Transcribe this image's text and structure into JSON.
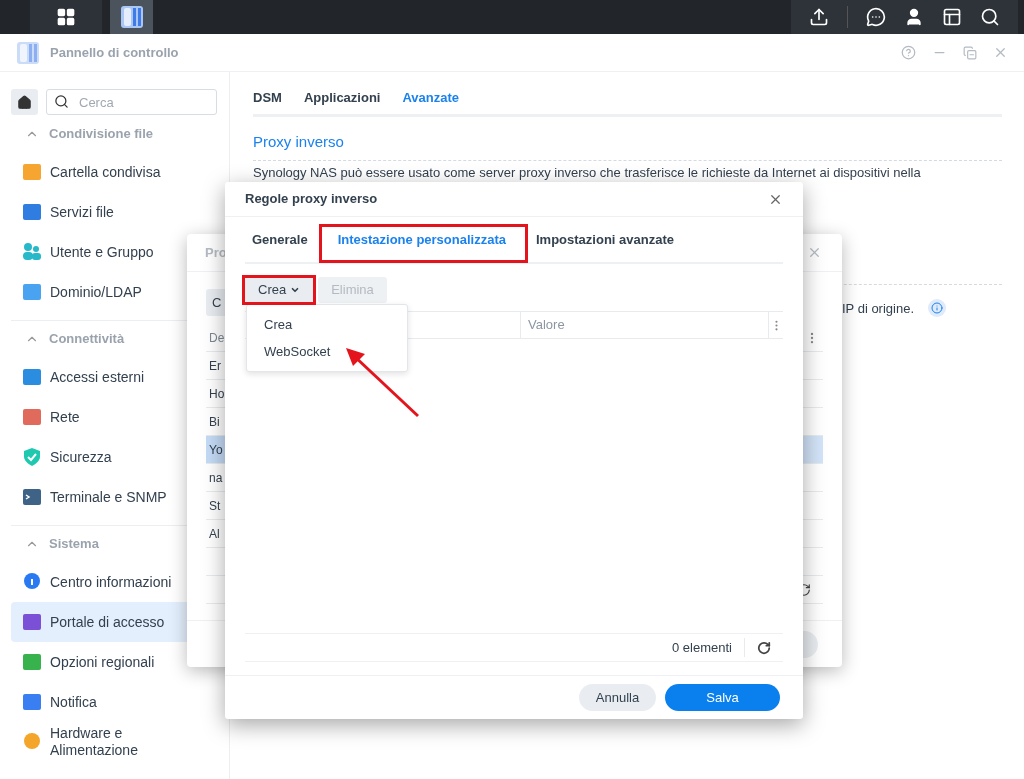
{
  "window": {
    "title": "Pannello di controllo"
  },
  "sidebar": {
    "search": {
      "placeholder": "Cerca"
    },
    "sections": [
      {
        "title": "Condivisione file",
        "expanded": true,
        "items": [
          {
            "label": "Cartella condivisa",
            "selected": false
          },
          {
            "label": "Servizi file",
            "selected": false
          },
          {
            "label": "Utente e Gruppo",
            "selected": false
          },
          {
            "label": "Dominio/LDAP",
            "selected": false
          }
        ]
      },
      {
        "title": "Connettività",
        "expanded": true,
        "items": [
          {
            "label": "Accessi esterni",
            "selected": false
          },
          {
            "label": "Rete",
            "selected": false
          },
          {
            "label": "Sicurezza",
            "selected": false
          },
          {
            "label": "Terminale e SNMP",
            "selected": false
          }
        ]
      },
      {
        "title": "Sistema",
        "expanded": true,
        "items": [
          {
            "label": "Centro informazioni",
            "selected": false
          },
          {
            "label": "Portale di accesso",
            "selected": true
          },
          {
            "label": "Opzioni regionali",
            "selected": false
          },
          {
            "label": "Notifica",
            "selected": false
          },
          {
            "label": "Hardware e Alimentazione",
            "selected": false
          }
        ]
      }
    ]
  },
  "main": {
    "tabs": [
      {
        "label": "DSM",
        "selected": false
      },
      {
        "label": "Applicazioni",
        "selected": false
      },
      {
        "label": "Avanzate",
        "selected": true
      }
    ],
    "section_title": "Proxy inverso",
    "description": "Synology NAS può essere usato come server proxy inverso che trasferisce le richieste da Internet ai dispositivi nella",
    "note": "IP di origine."
  },
  "back_dialog": {
    "title": "Pro",
    "button": "C",
    "header_cell": "De",
    "rows": [
      {
        "cell": "Er",
        "selected": false
      },
      {
        "cell": "Ho",
        "selected": false
      },
      {
        "cell": "Bi",
        "selected": false
      },
      {
        "cell": "Yo",
        "selected": true
      },
      {
        "cell": "na",
        "selected": false
      },
      {
        "cell": "St",
        "selected": false
      },
      {
        "cell": "Al",
        "selected": false
      }
    ]
  },
  "dialog": {
    "title": "Regole proxy inverso",
    "tabs": [
      {
        "label": "Generale",
        "selected": false
      },
      {
        "label": "Intestazione personalizzata",
        "selected": true
      },
      {
        "label": "Impostazioni avanzate",
        "selected": false
      }
    ],
    "create_button": "Crea",
    "delete_button": {
      "label": "Elimina",
      "disabled": true
    },
    "columns": [
      "Valore"
    ],
    "menu": [
      "Crea",
      "WebSocket"
    ],
    "count": "0 elementi",
    "cancel": "Annulla",
    "save": "Salva"
  }
}
